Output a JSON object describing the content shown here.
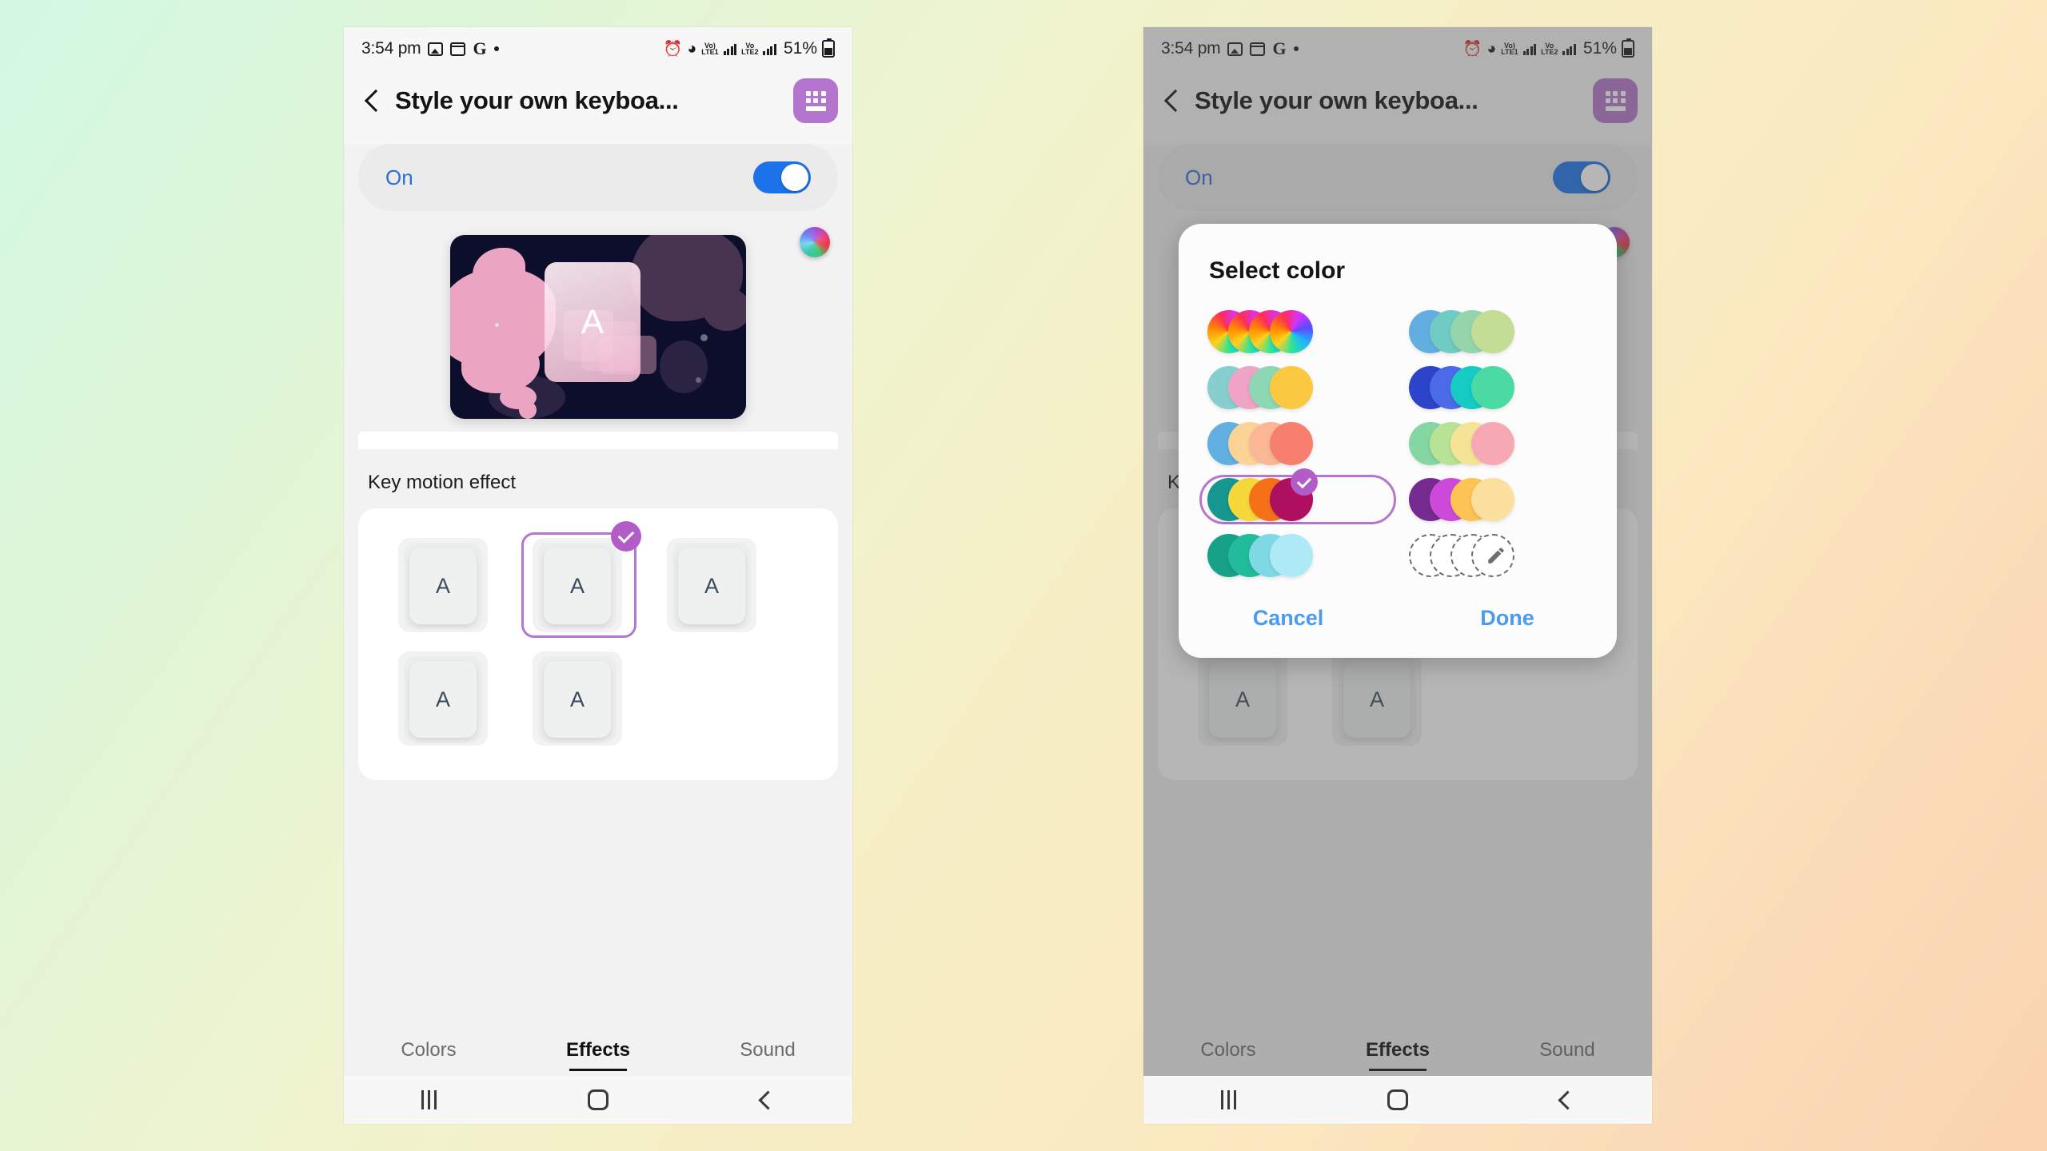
{
  "status_bar": {
    "time": "3:54 pm",
    "left_icons": [
      "photos-icon",
      "calendar-icon",
      "google-icon",
      "dot-indicator"
    ],
    "right_icons": [
      "alarm-icon",
      "wifi-icon",
      "volte1-signal-icon",
      "volte2-signal-icon"
    ],
    "battery_percent": "51%",
    "lte1_label": "Vo) LTE1",
    "lte2_label": "Vo LTE2"
  },
  "app_bar": {
    "back_label": "Back",
    "title": "Style your own keyboa...",
    "keyboard_button_label": "Keyboard"
  },
  "toggle": {
    "label": "On",
    "state": "on",
    "accent": "#1c72e8"
  },
  "preview": {
    "key_letter": "A",
    "color_wheel_label": "Color wheel",
    "background_color": "#0d0e2b",
    "blob_pink": "#eba5c2",
    "blob_purple": "#463450"
  },
  "section": {
    "key_motion_label": "Key motion effect"
  },
  "effects": {
    "selected_index": 1,
    "options": [
      {
        "letter": "A",
        "name": "motion-effect-1"
      },
      {
        "letter": "A",
        "name": "motion-effect-2"
      },
      {
        "letter": "A",
        "name": "motion-effect-3"
      },
      {
        "letter": "A",
        "name": "motion-effect-4"
      },
      {
        "letter": "A",
        "name": "motion-effect-5"
      }
    ],
    "selected_accent": "#b676cf"
  },
  "tabs": {
    "items": [
      {
        "label": "Colors",
        "active": false
      },
      {
        "label": "Effects",
        "active": true
      },
      {
        "label": "Sound",
        "active": false
      }
    ]
  },
  "nav_bar": {
    "recents": "Recents",
    "home": "Home",
    "back": "Back"
  },
  "dialog": {
    "title": "Select color",
    "selected_index": 6,
    "cancel_label": "Cancel",
    "done_label": "Done",
    "action_color": "#4a9bef",
    "selected_accent": "#b676cf",
    "swatches": [
      {
        "name": "rainbow-wheel-set",
        "type": "rainbow",
        "colors": [
          "#ff3b30",
          "#ffd21e",
          "#3ad66b",
          "#2d8bf0"
        ]
      },
      {
        "name": "blue-green-set",
        "type": "solid",
        "colors": [
          "#63aee0",
          "#6fcbc3",
          "#96d4ab",
          "#c3de94"
        ]
      },
      {
        "name": "teal-pink-yellow-set",
        "type": "solid",
        "colors": [
          "#87cfce",
          "#efa3c5",
          "#8ed7b4",
          "#fbc941"
        ]
      },
      {
        "name": "blue-indigo-teal-green-set",
        "type": "solid",
        "colors": [
          "#2b44c9",
          "#4b6ae8",
          "#15cbc4",
          "#4cdaa4"
        ]
      },
      {
        "name": "blue-peach-coral-set",
        "type": "solid",
        "colors": [
          "#62b0e0",
          "#fbd396",
          "#fbb795",
          "#f6806d"
        ]
      },
      {
        "name": "green-yellow-pink-set",
        "type": "solid",
        "colors": [
          "#84d6a2",
          "#b8e296",
          "#f6e496",
          "#f6a9b4"
        ]
      },
      {
        "name": "teal-yellow-orange-magenta-set",
        "type": "solid",
        "colors": [
          "#15968e",
          "#f6d83b",
          "#f4711a",
          "#ae0f5e"
        ]
      },
      {
        "name": "purple-violet-gold-cream-set",
        "type": "solid",
        "colors": [
          "#752b8f",
          "#cd4ad8",
          "#fbc454",
          "#fbdf9e"
        ]
      },
      {
        "name": "teal-shades-set",
        "type": "solid",
        "colors": [
          "#17a189",
          "#22bb9c",
          "#7fd9e4",
          "#aeeaf6"
        ]
      },
      {
        "name": "custom-color-set",
        "type": "custom",
        "colors": [
          "#ffffff",
          "#ffffff",
          "#ffffff",
          "#ffffff"
        ]
      }
    ]
  }
}
